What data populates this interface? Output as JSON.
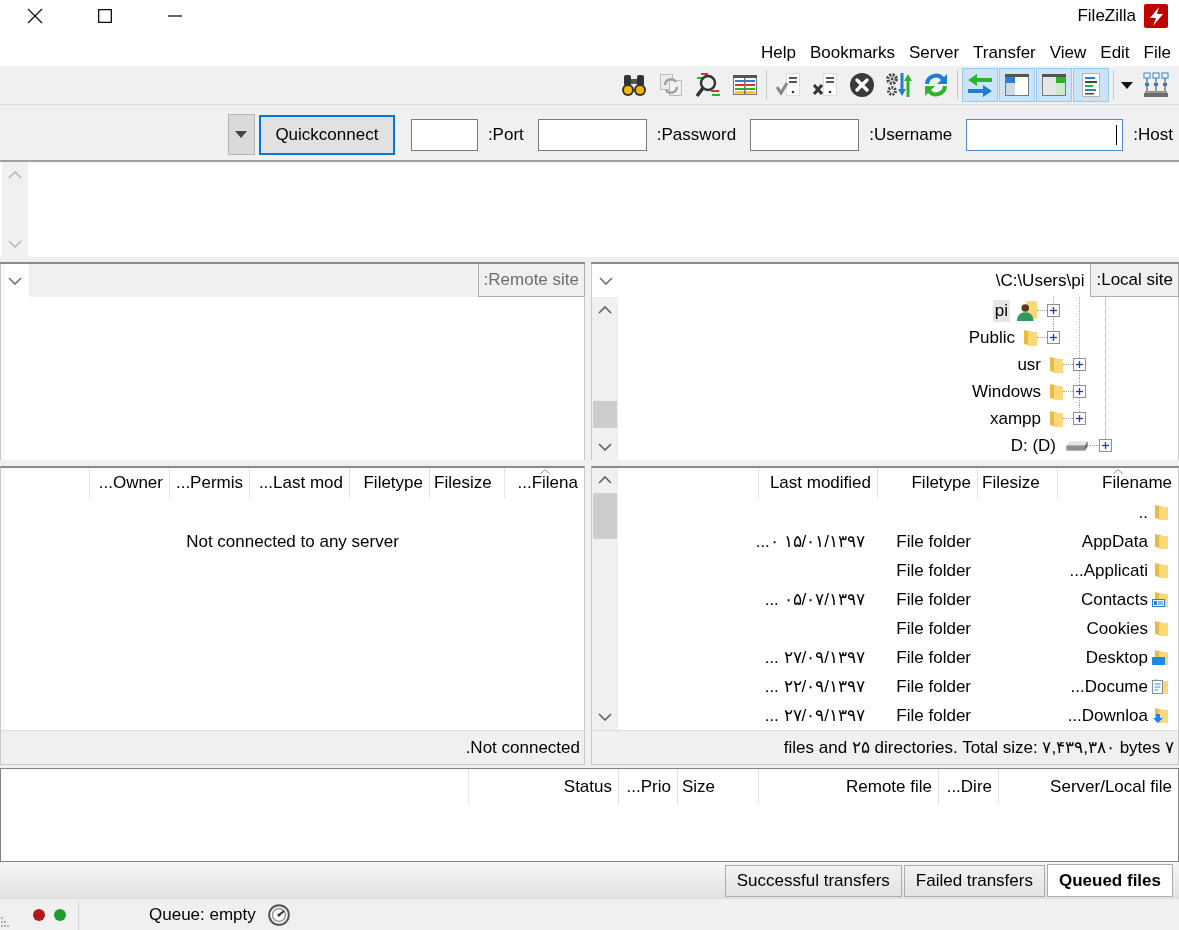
{
  "window": {
    "title": "FileZilla"
  },
  "menu": [
    "Help",
    "Bookmarks",
    "Server",
    "Transfer",
    "View",
    "Edit",
    "File"
  ],
  "toolbar": {
    "groups": [
      [
        {
          "kind": "search",
          "pressed": false
        },
        {
          "kind": "sync",
          "pressed": false
        },
        {
          "kind": "compare",
          "pressed": false
        },
        {
          "kind": "filter",
          "pressed": false
        }
      ],
      [
        {
          "kind": "reconnect",
          "pressed": false
        },
        {
          "kind": "disconnect",
          "pressed": false
        },
        {
          "kind": "cancel",
          "pressed": false
        },
        {
          "kind": "process-queue",
          "pressed": false
        },
        {
          "kind": "refresh",
          "pressed": false
        }
      ],
      [
        {
          "kind": "queue",
          "pressed": true
        },
        {
          "kind": "remote-tree",
          "pressed": true
        },
        {
          "kind": "local-tree",
          "pressed": true
        },
        {
          "kind": "log",
          "pressed": true
        }
      ],
      [
        {
          "kind": "dropdown",
          "pressed": false
        },
        {
          "kind": "site-manager",
          "pressed": false
        }
      ]
    ]
  },
  "quickconnect": {
    "button": "Quickconnect",
    "fields": [
      {
        "label": ":Port",
        "focused": false
      },
      {
        "label": ":Password",
        "focused": false
      },
      {
        "label": ":Username",
        "focused": false
      },
      {
        "label": ":Host",
        "focused": true
      }
    ]
  },
  "remote": {
    "site": {
      "label": ":Remote site",
      "disabled": true
    },
    "columns": [
      {
        "label": "...Owner",
        "sorted": false
      },
      {
        "label": "...Permis",
        "sorted": false
      },
      {
        "label": "...Last mod",
        "sorted": false
      },
      {
        "label": "Filetype",
        "sorted": false
      },
      {
        "label": "Filesize",
        "sorted": false
      },
      {
        "label": "...Filena",
        "sorted": true
      }
    ],
    "empty_message": "Not connected to any server",
    "status": ".Not connected"
  },
  "local": {
    "site": {
      "label": ":Local site",
      "path": "\\C:\\Users\\pi",
      "disabled": false
    },
    "tree": [
      {
        "children": [
          {
            "children": [
              {
                "label": "pi",
                "kind": "user-folder",
                "selected": true,
                "expanded": false
              },
              {
                "label": "Public",
                "kind": "folder",
                "selected": false,
                "expanded": false
              }
            ]
          },
          {
            "label": "usr",
            "kind": "folder",
            "selected": false,
            "expanded": false
          },
          {
            "label": "Windows",
            "kind": "folder",
            "selected": false,
            "expanded": false
          },
          {
            "label": "xampp",
            "kind": "folder",
            "selected": false,
            "expanded": false
          }
        ]
      },
      {
        "label": "D: (D)",
        "kind": "drive",
        "selected": false,
        "expanded": false
      }
    ],
    "columns": [
      {
        "label": "Last modified",
        "sorted": false
      },
      {
        "label": "Filetype",
        "sorted": false
      },
      {
        "label": "Filesize",
        "sorted": false
      },
      {
        "label": "Filename",
        "sorted": true
      }
    ],
    "files": [
      {
        "name": "..",
        "kind": "folder"
      },
      {
        "name": "AppData",
        "kind": "folder",
        "filetype": "File folder",
        "modified": "...۰ ۱۵/۰۱/۱۳۹۷"
      },
      {
        "name": "...Applicati",
        "kind": "folder",
        "filetype": "File folder"
      },
      {
        "name": "Contacts",
        "kind": "contacts",
        "filetype": "File folder",
        "modified": "... ۰۵/۰۷/۱۳۹۷"
      },
      {
        "name": "Cookies",
        "kind": "folder",
        "filetype": "File folder"
      },
      {
        "name": "Desktop",
        "kind": "desktop",
        "filetype": "File folder",
        "modified": "... ۲۷/۰۹/۱۳۹۷"
      },
      {
        "name": "...Docume",
        "kind": "documents",
        "filetype": "File folder",
        "modified": "... ۲۲/۰۹/۱۳۹۷"
      },
      {
        "name": "...Downloa",
        "kind": "downloads",
        "filetype": "File folder",
        "modified": "... ۲۷/۰۹/۱۳۹۷"
      }
    ],
    "status": "files and ۲۵ directories. Total size: ۷,۴۳۹,۳۸۰ bytes ۷"
  },
  "queue": {
    "columns": [
      "Status",
      "...Prio",
      "Size",
      "Remote file",
      "...Dire",
      "Server/Local file"
    ],
    "tabs": [
      {
        "label": "Successful transfers",
        "selected": false
      },
      {
        "label": "Failed transfers",
        "selected": false
      },
      {
        "label": "Queued files",
        "selected": true
      }
    ]
  },
  "status_bar": {
    "indicators": [
      {
        "color": "#b3191b"
      },
      {
        "color": "#1f9a2e"
      }
    ],
    "queue": "Queue: empty"
  }
}
